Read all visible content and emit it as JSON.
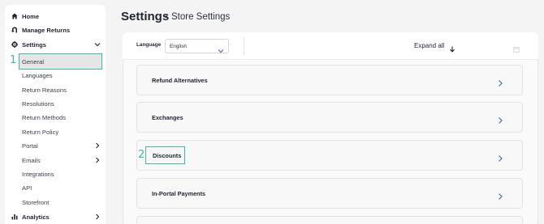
{
  "sidebar": {
    "items": [
      {
        "label": "Home",
        "icon": "home-icon"
      },
      {
        "label": "Manage Returns",
        "icon": "returns-icon"
      },
      {
        "label": "Settings",
        "icon": "gear-icon"
      },
      {
        "label": "General"
      },
      {
        "label": "Languages"
      },
      {
        "label": "Return Reasons"
      },
      {
        "label": "Resolutions"
      },
      {
        "label": "Return Methods"
      },
      {
        "label": "Return Policy"
      },
      {
        "label": "Portal"
      },
      {
        "label": "Emails"
      },
      {
        "label": "Integrations"
      },
      {
        "label": "API"
      },
      {
        "label": "Storefront"
      },
      {
        "label": "Analytics",
        "icon": "chart-icon"
      }
    ]
  },
  "markers": {
    "one": "1",
    "two": "2"
  },
  "header": {
    "title": "Settings",
    "separator": "•",
    "subtitle": "Store Settings"
  },
  "toolbar": {
    "language_label": "Language",
    "language_value": "English",
    "expand_all": "Expand all"
  },
  "sections": [
    {
      "title": "Refund Alternatives"
    },
    {
      "title": "Exchanges"
    },
    {
      "title": "Discounts"
    },
    {
      "title": "In-Portal Payments"
    }
  ],
  "colors": {
    "accent": "#3fb8a8",
    "chevron": "#4a6ea8"
  }
}
